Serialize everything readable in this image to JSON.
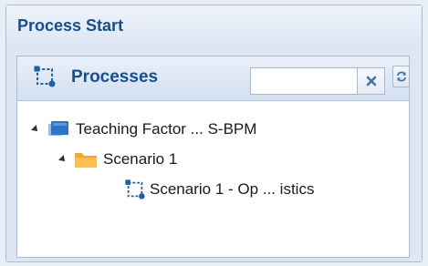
{
  "outer_panel": {
    "title": "Process Start"
  },
  "processes_panel": {
    "title": "Processes",
    "title_icon": "process-icon",
    "search": {
      "value": "",
      "placeholder": ""
    },
    "clear_icon": "close-icon",
    "refresh_icon": "refresh-icon"
  },
  "tree": {
    "root": {
      "label": "Teaching Factor ... S-BPM",
      "icon": "layers-icon",
      "expanded": true
    },
    "scenario": {
      "label": "Scenario 1",
      "icon": "folder-icon",
      "expanded": true
    },
    "process": {
      "label": "Scenario 1 - Op ... istics",
      "icon": "process-icon"
    }
  },
  "colors": {
    "title_blue": "#164e91",
    "panel_border": "#a9bdd8",
    "folder_orange": "#f6a623",
    "icon_blue": "#1f5fa6"
  }
}
